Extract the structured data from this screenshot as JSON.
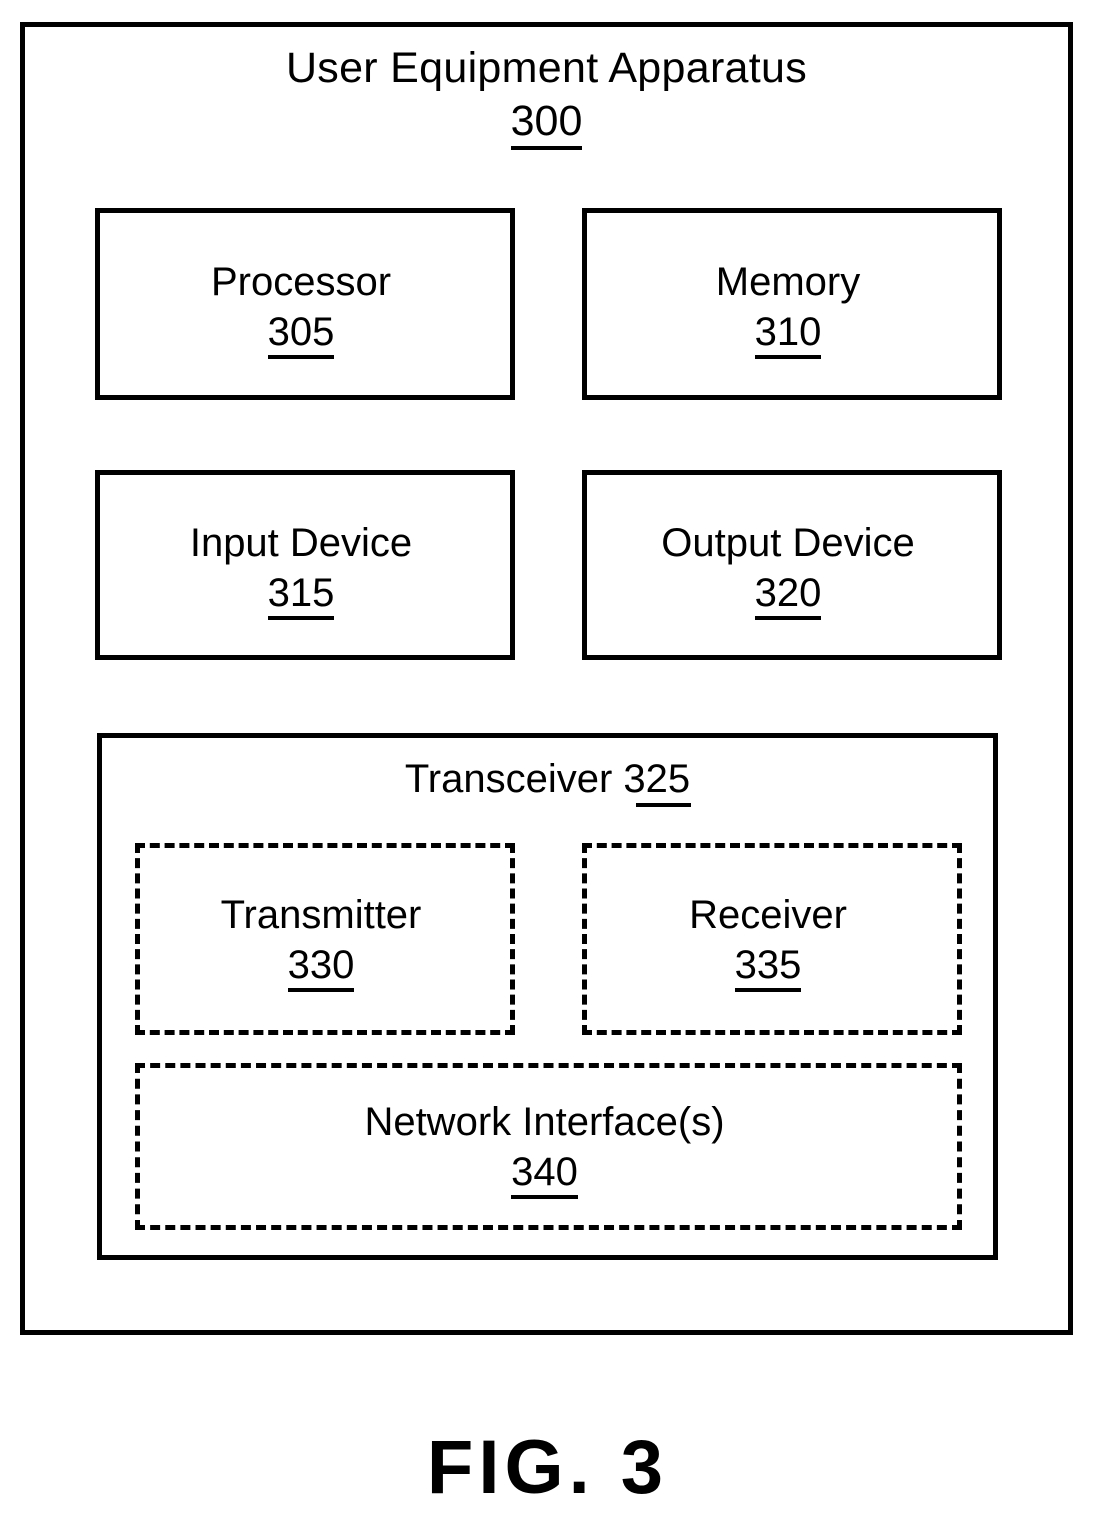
{
  "figure": {
    "caption": "FIG. 3",
    "apparatus": {
      "title": "User Equipment Apparatus",
      "reference": "300"
    },
    "components": [
      {
        "key": "processor",
        "name": "Processor",
        "reference": "305"
      },
      {
        "key": "memory",
        "name": "Memory",
        "reference": "310"
      },
      {
        "key": "input_device",
        "name": "Input Device",
        "reference": "315"
      },
      {
        "key": "output_device",
        "name": "Output Device",
        "reference": "320"
      },
      {
        "key": "transceiver",
        "name": "Transceiver",
        "reference": "325"
      },
      {
        "key": "transmitter",
        "name": "Transmitter",
        "reference": "330"
      },
      {
        "key": "receiver",
        "name": "Receiver",
        "reference": "335"
      },
      {
        "key": "network_interface",
        "name": "Network Interface(s)",
        "reference": "340"
      }
    ],
    "transceiver_header": {
      "name": "Transceiver",
      "reference": "325",
      "separator": " "
    },
    "colors": {
      "line": "#000000",
      "background": "#ffffff",
      "text": "#000000"
    }
  }
}
